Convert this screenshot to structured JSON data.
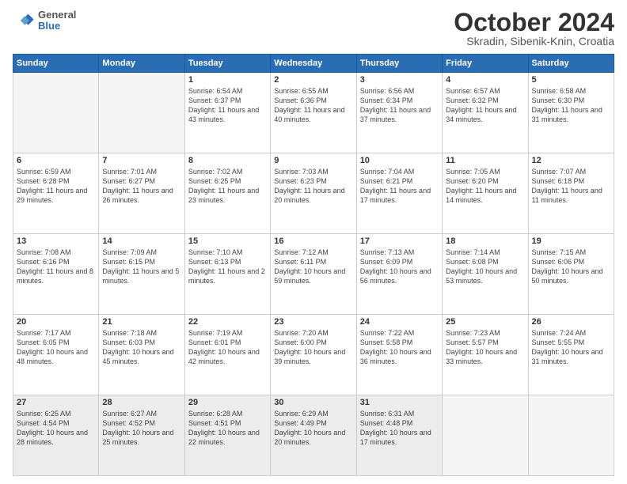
{
  "header": {
    "logo": {
      "general": "General",
      "blue": "Blue"
    },
    "title": "October 2024",
    "location": "Skradin, Sibenik-Knin, Croatia"
  },
  "columns": [
    "Sunday",
    "Monday",
    "Tuesday",
    "Wednesday",
    "Thursday",
    "Friday",
    "Saturday"
  ],
  "weeks": [
    [
      {
        "day": "",
        "sunrise": "",
        "sunset": "",
        "daylight": ""
      },
      {
        "day": "",
        "sunrise": "",
        "sunset": "",
        "daylight": ""
      },
      {
        "day": "1",
        "sunrise": "Sunrise: 6:54 AM",
        "sunset": "Sunset: 6:37 PM",
        "daylight": "Daylight: 11 hours and 43 minutes."
      },
      {
        "day": "2",
        "sunrise": "Sunrise: 6:55 AM",
        "sunset": "Sunset: 6:36 PM",
        "daylight": "Daylight: 11 hours and 40 minutes."
      },
      {
        "day": "3",
        "sunrise": "Sunrise: 6:56 AM",
        "sunset": "Sunset: 6:34 PM",
        "daylight": "Daylight: 11 hours and 37 minutes."
      },
      {
        "day": "4",
        "sunrise": "Sunrise: 6:57 AM",
        "sunset": "Sunset: 6:32 PM",
        "daylight": "Daylight: 11 hours and 34 minutes."
      },
      {
        "day": "5",
        "sunrise": "Sunrise: 6:58 AM",
        "sunset": "Sunset: 6:30 PM",
        "daylight": "Daylight: 11 hours and 31 minutes."
      }
    ],
    [
      {
        "day": "6",
        "sunrise": "Sunrise: 6:59 AM",
        "sunset": "Sunset: 6:28 PM",
        "daylight": "Daylight: 11 hours and 29 minutes."
      },
      {
        "day": "7",
        "sunrise": "Sunrise: 7:01 AM",
        "sunset": "Sunset: 6:27 PM",
        "daylight": "Daylight: 11 hours and 26 minutes."
      },
      {
        "day": "8",
        "sunrise": "Sunrise: 7:02 AM",
        "sunset": "Sunset: 6:25 PM",
        "daylight": "Daylight: 11 hours and 23 minutes."
      },
      {
        "day": "9",
        "sunrise": "Sunrise: 7:03 AM",
        "sunset": "Sunset: 6:23 PM",
        "daylight": "Daylight: 11 hours and 20 minutes."
      },
      {
        "day": "10",
        "sunrise": "Sunrise: 7:04 AM",
        "sunset": "Sunset: 6:21 PM",
        "daylight": "Daylight: 11 hours and 17 minutes."
      },
      {
        "day": "11",
        "sunrise": "Sunrise: 7:05 AM",
        "sunset": "Sunset: 6:20 PM",
        "daylight": "Daylight: 11 hours and 14 minutes."
      },
      {
        "day": "12",
        "sunrise": "Sunrise: 7:07 AM",
        "sunset": "Sunset: 6:18 PM",
        "daylight": "Daylight: 11 hours and 11 minutes."
      }
    ],
    [
      {
        "day": "13",
        "sunrise": "Sunrise: 7:08 AM",
        "sunset": "Sunset: 6:16 PM",
        "daylight": "Daylight: 11 hours and 8 minutes."
      },
      {
        "day": "14",
        "sunrise": "Sunrise: 7:09 AM",
        "sunset": "Sunset: 6:15 PM",
        "daylight": "Daylight: 11 hours and 5 minutes."
      },
      {
        "day": "15",
        "sunrise": "Sunrise: 7:10 AM",
        "sunset": "Sunset: 6:13 PM",
        "daylight": "Daylight: 11 hours and 2 minutes."
      },
      {
        "day": "16",
        "sunrise": "Sunrise: 7:12 AM",
        "sunset": "Sunset: 6:11 PM",
        "daylight": "Daylight: 10 hours and 59 minutes."
      },
      {
        "day": "17",
        "sunrise": "Sunrise: 7:13 AM",
        "sunset": "Sunset: 6:09 PM",
        "daylight": "Daylight: 10 hours and 56 minutes."
      },
      {
        "day": "18",
        "sunrise": "Sunrise: 7:14 AM",
        "sunset": "Sunset: 6:08 PM",
        "daylight": "Daylight: 10 hours and 53 minutes."
      },
      {
        "day": "19",
        "sunrise": "Sunrise: 7:15 AM",
        "sunset": "Sunset: 6:06 PM",
        "daylight": "Daylight: 10 hours and 50 minutes."
      }
    ],
    [
      {
        "day": "20",
        "sunrise": "Sunrise: 7:17 AM",
        "sunset": "Sunset: 6:05 PM",
        "daylight": "Daylight: 10 hours and 48 minutes."
      },
      {
        "day": "21",
        "sunrise": "Sunrise: 7:18 AM",
        "sunset": "Sunset: 6:03 PM",
        "daylight": "Daylight: 10 hours and 45 minutes."
      },
      {
        "day": "22",
        "sunrise": "Sunrise: 7:19 AM",
        "sunset": "Sunset: 6:01 PM",
        "daylight": "Daylight: 10 hours and 42 minutes."
      },
      {
        "day": "23",
        "sunrise": "Sunrise: 7:20 AM",
        "sunset": "Sunset: 6:00 PM",
        "daylight": "Daylight: 10 hours and 39 minutes."
      },
      {
        "day": "24",
        "sunrise": "Sunrise: 7:22 AM",
        "sunset": "Sunset: 5:58 PM",
        "daylight": "Daylight: 10 hours and 36 minutes."
      },
      {
        "day": "25",
        "sunrise": "Sunrise: 7:23 AM",
        "sunset": "Sunset: 5:57 PM",
        "daylight": "Daylight: 10 hours and 33 minutes."
      },
      {
        "day": "26",
        "sunrise": "Sunrise: 7:24 AM",
        "sunset": "Sunset: 5:55 PM",
        "daylight": "Daylight: 10 hours and 31 minutes."
      }
    ],
    [
      {
        "day": "27",
        "sunrise": "Sunrise: 6:25 AM",
        "sunset": "Sunset: 4:54 PM",
        "daylight": "Daylight: 10 hours and 28 minutes."
      },
      {
        "day": "28",
        "sunrise": "Sunrise: 6:27 AM",
        "sunset": "Sunset: 4:52 PM",
        "daylight": "Daylight: 10 hours and 25 minutes."
      },
      {
        "day": "29",
        "sunrise": "Sunrise: 6:28 AM",
        "sunset": "Sunset: 4:51 PM",
        "daylight": "Daylight: 10 hours and 22 minutes."
      },
      {
        "day": "30",
        "sunrise": "Sunrise: 6:29 AM",
        "sunset": "Sunset: 4:49 PM",
        "daylight": "Daylight: 10 hours and 20 minutes."
      },
      {
        "day": "31",
        "sunrise": "Sunrise: 6:31 AM",
        "sunset": "Sunset: 4:48 PM",
        "daylight": "Daylight: 10 hours and 17 minutes."
      },
      {
        "day": "",
        "sunrise": "",
        "sunset": "",
        "daylight": ""
      },
      {
        "day": "",
        "sunrise": "",
        "sunset": "",
        "daylight": ""
      }
    ]
  ]
}
